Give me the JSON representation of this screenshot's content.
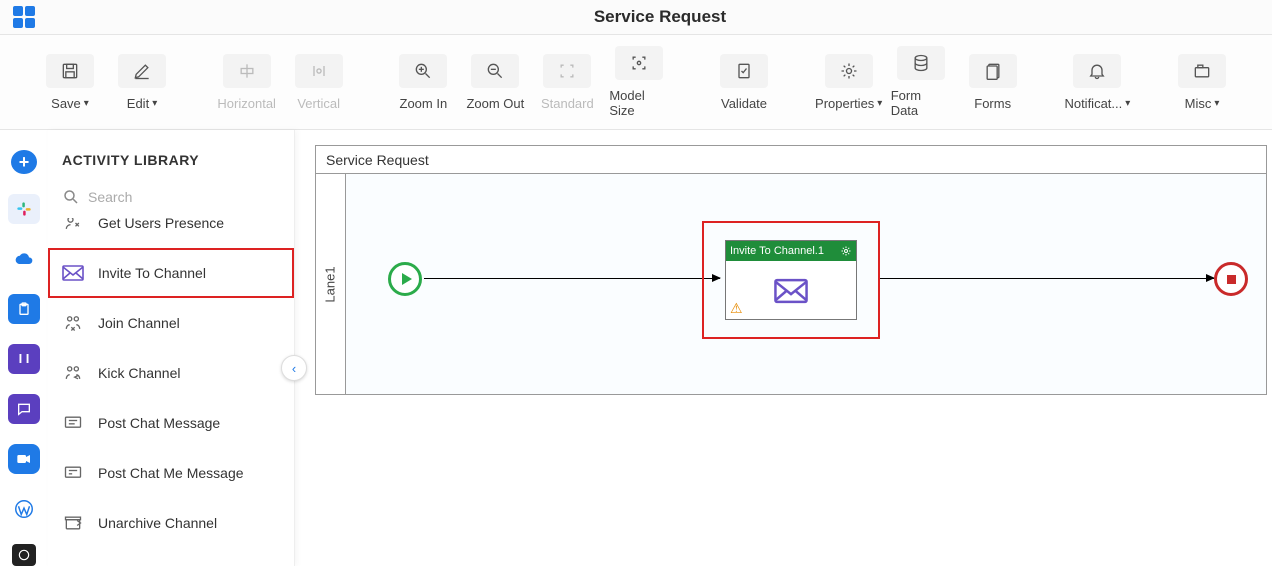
{
  "header": {
    "title": "Service Request"
  },
  "toolbar": {
    "save": "Save",
    "edit": "Edit",
    "horizontal": "Horizontal",
    "vertical": "Vertical",
    "zoom_in": "Zoom In",
    "zoom_out": "Zoom Out",
    "standard": "Standard",
    "model_size": "Model Size",
    "validate": "Validate",
    "properties": "Properties",
    "form_data": "Form Data",
    "forms": "Forms",
    "notifications": "Notificat...",
    "misc": "Misc"
  },
  "activity_panel": {
    "title": "ACTIVITY LIBRARY",
    "search_placeholder": "Search",
    "items": [
      {
        "label": "Get Users Presence"
      },
      {
        "label": "Invite To Channel",
        "highlighted": true
      },
      {
        "label": "Join Channel"
      },
      {
        "label": "Kick Channel"
      },
      {
        "label": "Post Chat Message"
      },
      {
        "label": "Post Chat Me Message"
      },
      {
        "label": "Unarchive Channel"
      }
    ]
  },
  "canvas": {
    "process_title": "Service Request",
    "lane_label": "Lane1",
    "task_title": "Invite To Channel.1"
  }
}
